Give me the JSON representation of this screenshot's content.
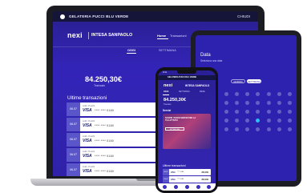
{
  "laptop": {
    "shop_name": "GELATERIA PUCCI BLU VERDE",
    "exit_label": "CHIUDI",
    "brand": "nexi",
    "partner_brand": "INTESA SANPAOLO",
    "nav": [
      "Home",
      "Transazioni"
    ],
    "tabs": [
      "OGGI",
      "SETTIMANA"
    ],
    "amount": "84.250,30€",
    "amount_label": "Transato",
    "section_title": "Ultime transazioni",
    "rows": [
      {
        "date": "06.07",
        "desc": "Auth. Pos01",
        "card": "VISA",
        "mask": "**** **** 0160"
      },
      {
        "date": "06.07",
        "desc": "Auth. Pos01",
        "card": "VISA",
        "mask": "**** **** 0160"
      },
      {
        "date": "06.07",
        "desc": "Auth. Pos01",
        "card": "VISA",
        "mask": "**** **** 0160"
      },
      {
        "date": "06.07",
        "desc": "Auth. Pos01",
        "card": "VISA",
        "mask": "**** **** 0160"
      },
      {
        "date": "06.07",
        "desc": "Auth. Pos01",
        "card": "VISA",
        "mask": "**** **** 0160"
      }
    ]
  },
  "tablet": {
    "title": "Data",
    "subtitle": "Seleziona una data",
    "buttons": [
      "GIORNO",
      "SETTIMANA"
    ],
    "calendar": {
      "rows": 5,
      "cols": 7,
      "selected": [
        3,
        3
      ]
    }
  },
  "phone": {
    "time": "9:41",
    "shop_name": "GELATERIA PUCCI BLU VERDE",
    "brand": "nexi",
    "partner_brand": "INTESA SANPAOLO",
    "tabs": [
      "OGGI",
      "SETTIMANA",
      "MESE"
    ],
    "amount": "84.250,30€",
    "amount_label": "Transato",
    "services_title": "Servizi",
    "promo_text": "SCOPRI I NUOVI SERVIZI PER LA TUA ATTIVITÀ",
    "promo_button": "ATTIVA ORA",
    "section_title": "Ultime transazioni",
    "rows": [
      {
        "date": "06.07",
        "card": "VISA",
        "mask": "**** 0160",
        "amount": "260,00€"
      },
      {
        "date": "06.07",
        "card": "VISA",
        "mask": "**** 0160",
        "amount": "300,00€"
      }
    ]
  },
  "colors": {
    "screen_blue": "#2d22b0",
    "accent_cyan": "#27c2f0",
    "device_frame": "#1b1b22"
  }
}
